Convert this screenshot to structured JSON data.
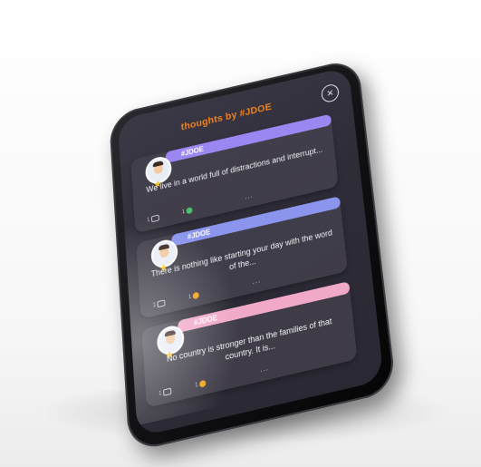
{
  "header": {
    "title": "thoughts by #JDOE",
    "close_icon": "close-icon"
  },
  "colors": {
    "accent": "#f0821f",
    "card1_band": "#9c86f1",
    "card2_band": "#8b95ee",
    "card3_band": "#f1a9c8",
    "like_green": "#47c46b",
    "like_orange": "#f0a31a"
  },
  "cards": [
    {
      "tag": "#JDOE",
      "text": "We live in a world full of distractions and interrupt...",
      "comments": "1",
      "likes": "1",
      "more": "..."
    },
    {
      "tag": "#JDOE",
      "text": "There is nothing like starting your day with the word of the...",
      "comments": "1",
      "likes": "1",
      "more": "..."
    },
    {
      "tag": "#JDOE",
      "text": "No country is stronger than the families of that country. It is...",
      "comments": "1",
      "likes": "1",
      "more": "..."
    }
  ]
}
